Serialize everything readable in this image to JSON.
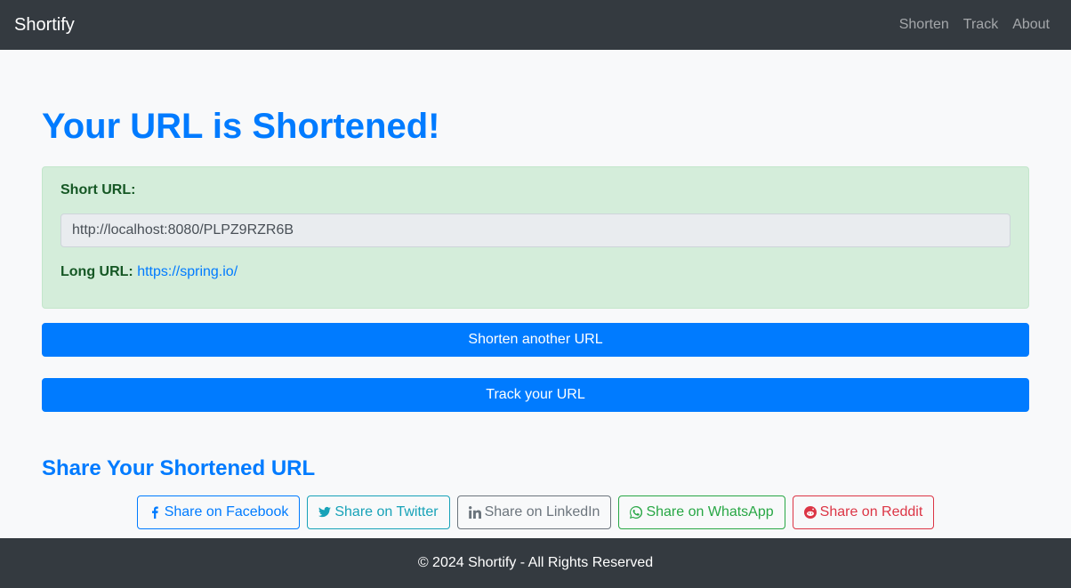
{
  "navbar": {
    "brand": "Shortify",
    "links": [
      "Shorten",
      "Track",
      "About"
    ]
  },
  "main": {
    "title": "Your URL is Shortened!",
    "short_url_label": "Short URL:",
    "short_url_value": "http://localhost:8080/PLPZ9RZR6B",
    "long_url_label": "Long URL:",
    "long_url_value": "https://spring.io/",
    "shorten_another_label": "Shorten another URL",
    "track_label": "Track your URL"
  },
  "share": {
    "title": "Share Your Shortened URL",
    "buttons": [
      {
        "label": "Share on Facebook",
        "icon": "facebook-icon",
        "color": "#007bff"
      },
      {
        "label": "Share on Twitter",
        "icon": "twitter-icon",
        "color": "#17a2b8"
      },
      {
        "label": "Share on LinkedIn",
        "icon": "linkedin-icon",
        "color": "#6c757d"
      },
      {
        "label": "Share on WhatsApp",
        "icon": "whatsapp-icon",
        "color": "#28a745"
      },
      {
        "label": "Share on Reddit",
        "icon": "reddit-icon",
        "color": "#dc3545"
      }
    ]
  },
  "footer": {
    "text": "© 2024 Shortify - All Rights Reserved"
  }
}
